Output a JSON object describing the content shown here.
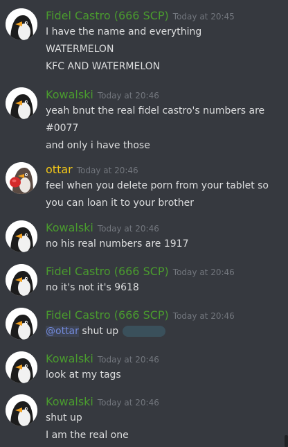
{
  "colors": {
    "background": "#36393f",
    "name_green": "#4a9b2e",
    "name_yellow": "#f2c718",
    "text": "#dcddde",
    "timestamp": "#72767d",
    "mention": "#7289da"
  },
  "messages": [
    {
      "author": "Fidel Castro (666 SCP)",
      "timestamp": "Today at 20:45",
      "avatar": "penguin-avatar",
      "lines": [
        "I have the name and everything",
        "WATERMELON",
        "KFC AND WATERMELON"
      ]
    },
    {
      "author": "Kowalski",
      "timestamp": "Today at 20:46",
      "avatar": "penguin-avatar",
      "lines": [
        "yeah bnut the real fidel castro's numbers are",
        "#0077",
        "and only i have those"
      ]
    },
    {
      "author": "ottar",
      "timestamp": "Today at 20:46",
      "avatar": "boxing-penguin-avatar",
      "lines": [
        "feel when you delete porn from your tablet so you can loan it to your brother"
      ]
    },
    {
      "author": "Kowalski",
      "timestamp": "Today at 20:46",
      "avatar": "penguin-avatar",
      "lines": [
        "no his real numbers are 1917"
      ]
    },
    {
      "author": "Fidel Castro (666 SCP)",
      "timestamp": "Today at 20:46",
      "avatar": "penguin-avatar",
      "lines": [
        "no it's not it's 9618"
      ]
    },
    {
      "author": "Fidel Castro (666 SCP)",
      "timestamp": "Today at 20:46",
      "avatar": "penguin-avatar",
      "mention": "@ottar",
      "lines": [
        "shut up"
      ]
    },
    {
      "author": "Kowalski",
      "timestamp": "Today at 20:46",
      "avatar": "penguin-avatar",
      "lines": [
        "look at my tags"
      ]
    },
    {
      "author": "Kowalski",
      "timestamp": "Today at 20:46",
      "avatar": "penguin-avatar",
      "lines": [
        "shut up",
        "I am the real one"
      ]
    }
  ]
}
